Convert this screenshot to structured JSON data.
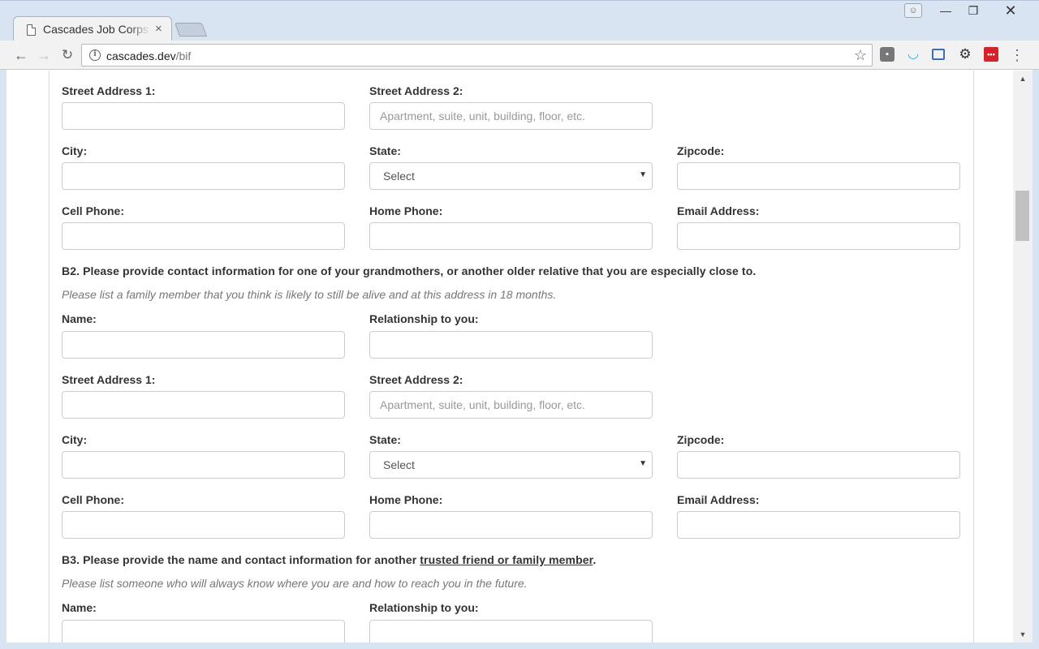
{
  "browser": {
    "tab_title": "Cascades Job Corps",
    "tab_close": "×",
    "url_host": "cascades.dev",
    "url_path": "/bif",
    "window_controls": {
      "minimize": "—",
      "maximize": "❐",
      "close": "✕"
    },
    "nav": {
      "back": "←",
      "forward": "→",
      "reload": "↻"
    },
    "icons": {
      "info": "i",
      "star": "☆",
      "menu": "⋮",
      "ext_ghostery": "▪",
      "ext_wifi": "◡",
      "ext_capture": "",
      "ext_settings": "⚙",
      "ext_lastpass": "•••",
      "profile": "👤"
    }
  },
  "form": {
    "block1": {
      "street1_label": "Street Address 1:",
      "street2_label": "Street Address 2:",
      "street2_placeholder": "Apartment, suite, unit, building, floor, etc.",
      "city_label": "City:",
      "state_label": "State:",
      "state_value": "Select",
      "zip_label": "Zipcode:",
      "cell_label": "Cell Phone:",
      "home_label": "Home Phone:",
      "email_label": "Email Address:"
    },
    "b2": {
      "question": "B2. Please provide contact information for one of your grandmothers, or another older relative that you are especially close to.",
      "hint": "Please list a family member that you think is likely to still be alive and at this address in 18 months.",
      "name_label": "Name:",
      "relationship_label": "Relationship to you:",
      "street1_label": "Street Address 1:",
      "street2_label": "Street Address 2:",
      "street2_placeholder": "Apartment, suite, unit, building, floor, etc.",
      "city_label": "City:",
      "state_label": "State:",
      "state_value": "Select",
      "zip_label": "Zipcode:",
      "cell_label": "Cell Phone:",
      "home_label": "Home Phone:",
      "email_label": "Email Address:"
    },
    "b3": {
      "question_prefix": "B3. Please provide the name and contact information for another ",
      "question_link": "trusted friend or family member",
      "question_suffix": ".",
      "hint": "Please list someone who will always know where you are and how to reach you in the future.",
      "name_label": "Name:",
      "relationship_label": "Relationship to you:"
    }
  },
  "scrollbar": {
    "up": "▲",
    "down": "▼",
    "position_fraction": 0.23
  }
}
